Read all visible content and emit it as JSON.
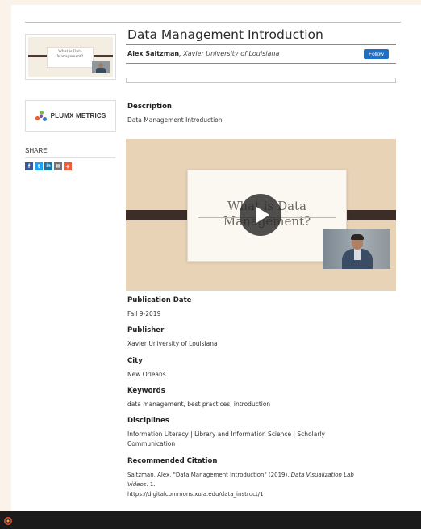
{
  "item": {
    "title": "Data Management Introduction",
    "author_name": "Alex Saltzman",
    "author_affiliation": ", Xavier University of Louisiana",
    "follow_label": "Follow"
  },
  "thumbnail": {
    "slide_text": "What is Data Management?"
  },
  "plumx": {
    "label": "PLUMX METRICS"
  },
  "share": {
    "label": "SHARE",
    "icons": [
      {
        "name": "facebook-icon",
        "glyph": "f",
        "color": "#3b5998"
      },
      {
        "name": "twitter-icon",
        "glyph": "t",
        "color": "#1da1f2"
      },
      {
        "name": "linkedin-icon",
        "glyph": "in",
        "color": "#0e76a8"
      },
      {
        "name": "email-icon",
        "glyph": "✉",
        "color": "#737373"
      },
      {
        "name": "more-share-icon",
        "glyph": "+",
        "color": "#f05a36"
      }
    ]
  },
  "video": {
    "slide_line1": "What is Data",
    "slide_line2": "Management?"
  },
  "sections": {
    "description_heading": "Description",
    "description": "Data Management Introduction",
    "pubdate_heading": "Publication Date",
    "pubdate": "Fall 9-2019",
    "publisher_heading": "Publisher",
    "publisher": "Xavier University of Louisiana",
    "city_heading": "City",
    "city": "New Orleans",
    "keywords_heading": "Keywords",
    "keywords": "data management, best practices, introduction",
    "disciplines_heading": "Disciplines",
    "disciplines_line1": "Information Literacy | Library and Information Science | Scholarly",
    "disciplines_line2": "Communication",
    "citation_heading": "Recommended Citation",
    "citation_part1": "Saltzman, Alex, \"Data Management Introduction\" (2019). ",
    "citation_series": "Data Visualization Lab",
    "citation_series2": "Videos",
    "citation_part2": ". 1.",
    "citation_url": "https://digitalcommons.xula.edu/data_instruct/1"
  },
  "colors": {
    "accent": "#1d6fc7",
    "page_background": "#fbf3e9",
    "footer": "#1b1b1b"
  }
}
